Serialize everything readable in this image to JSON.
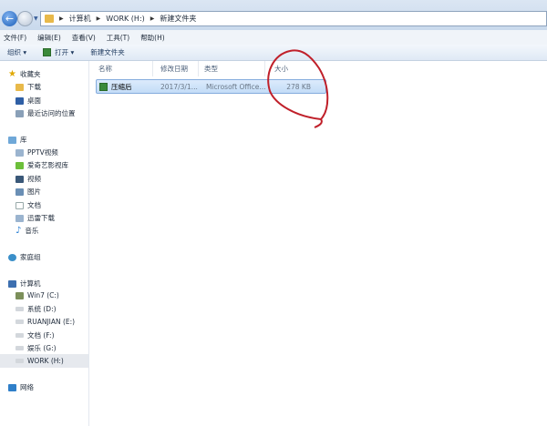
{
  "address": {
    "crumbs": [
      "计算机",
      "WORK (H:)",
      "新建文件夹"
    ]
  },
  "menu": [
    "文件(F)",
    "编辑(E)",
    "查看(V)",
    "工具(T)",
    "帮助(H)"
  ],
  "toolbar": {
    "organize": "组织 ▾",
    "open": "打开 ▾",
    "new_folder": "新建文件夹"
  },
  "columns": [
    "名称",
    "修改日期",
    "类型",
    "大小"
  ],
  "files": [
    {
      "name": "压缩后",
      "date": "2017/3/1...",
      "type": "Microsoft Office...",
      "size": "278 KB"
    }
  ],
  "sidebar": {
    "favorites": {
      "label": "收藏夹",
      "items": [
        "下载",
        "桌面",
        "最近访问的位置"
      ]
    },
    "library": {
      "label": "库",
      "items": [
        "PPTV视频",
        "爱奇艺影视库",
        "视频",
        "图片",
        "文档",
        "迅雷下载",
        "音乐"
      ]
    },
    "homegroup": "家庭组",
    "computer": {
      "label": "计算机",
      "items": [
        "Win7 (C:)",
        "系统 (D:)",
        "RUANJIAN (E:)",
        "文档 (F:)",
        "娱乐 (G:)",
        "WORK (H:)"
      ]
    },
    "network": "网络"
  },
  "colors": {
    "annotation": "#c0202a",
    "selection": "#cfe3fa"
  }
}
